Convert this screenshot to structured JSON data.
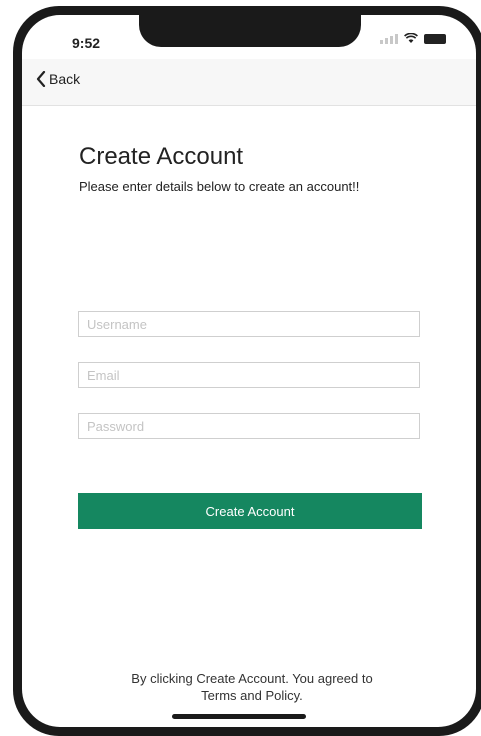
{
  "status_bar": {
    "time": "9:52"
  },
  "nav": {
    "back_label": "Back"
  },
  "content": {
    "title": "Create Account",
    "subtitle": "Please enter details below to create an account!!"
  },
  "form": {
    "username_placeholder": "Username",
    "email_placeholder": "Email",
    "password_placeholder": "Password",
    "submit_label": "Create Account"
  },
  "footer": {
    "line1": "By clicking Create Account.  You agreed to",
    "line2": "Terms and Policy."
  },
  "colors": {
    "accent": "#158760"
  }
}
